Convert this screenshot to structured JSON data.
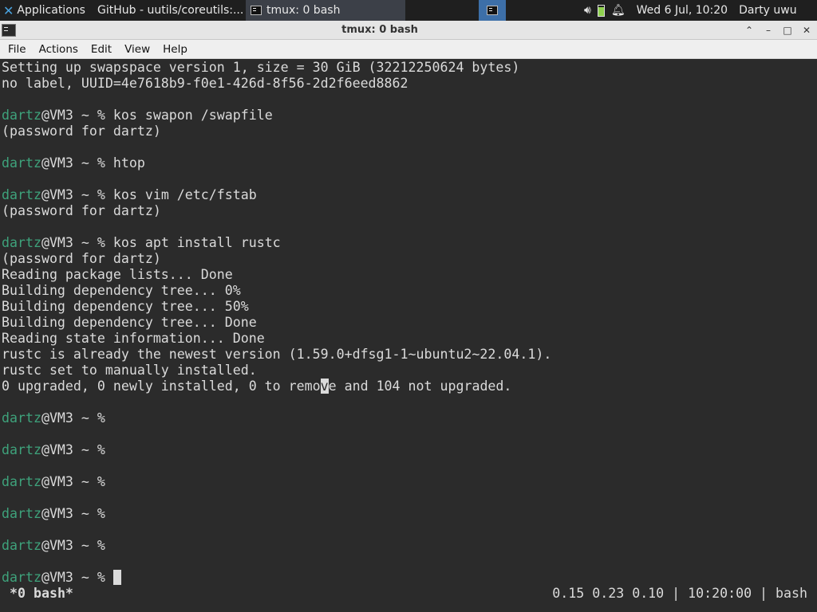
{
  "panel": {
    "applications_label": "Applications",
    "tasks": [
      {
        "label": "GitHub - uutils/coreutils:...",
        "icon": "firefox-icon"
      },
      {
        "label": "tmux: 0 bash",
        "icon": "terminal-icon"
      }
    ],
    "clock": "Wed  6 Jul, 10:20",
    "user": "Darty uwu",
    "accent": "#3d6fa8"
  },
  "window": {
    "title": "tmux: 0 bash"
  },
  "menubar": {
    "items": [
      "File",
      "Actions",
      "Edit",
      "View",
      "Help"
    ]
  },
  "terminal": {
    "colors": {
      "background": "#2b2b2b",
      "text": "#dadada",
      "prompt_user": "#3ea27b"
    },
    "prompt": {
      "user": "dartz",
      "rest": "@VM3 ~ % "
    },
    "lines": [
      {
        "type": "text",
        "text": "Setting up swapspace version 1, size = 30 GiB (32212250624 bytes)"
      },
      {
        "type": "text",
        "text": "no label, UUID=4e7618b9-f0e1-426d-8f56-2d2f6eed8862"
      },
      {
        "type": "blank"
      },
      {
        "type": "prompt",
        "cmd": "kos swapon /swapfile"
      },
      {
        "type": "text",
        "text": "(password for dartz)"
      },
      {
        "type": "blank"
      },
      {
        "type": "prompt",
        "cmd": "htop"
      },
      {
        "type": "blank"
      },
      {
        "type": "prompt",
        "cmd": "kos vim /etc/fstab"
      },
      {
        "type": "text",
        "text": "(password for dartz)"
      },
      {
        "type": "blank"
      },
      {
        "type": "prompt",
        "cmd": "kos apt install rustc"
      },
      {
        "type": "text",
        "text": "(password for dartz)"
      },
      {
        "type": "text",
        "text": "Reading package lists... Done"
      },
      {
        "type": "text",
        "text": "Building dependency tree... 0%"
      },
      {
        "type": "text",
        "text": "Building dependency tree... 50%"
      },
      {
        "type": "text",
        "text": "Building dependency tree... Done"
      },
      {
        "type": "text",
        "text": "Reading state information... Done"
      },
      {
        "type": "text",
        "text": "rustc is already the newest version (1.59.0+dfsg1-1~ubuntu2~22.04.1)."
      },
      {
        "type": "text",
        "text": "rustc set to manually installed."
      },
      {
        "type": "highlight",
        "before": "0 upgraded, 0 newly installed, 0 to remo",
        "hl": "v",
        "after": "e and 104 not upgraded."
      },
      {
        "type": "blank"
      },
      {
        "type": "prompt",
        "cmd": ""
      },
      {
        "type": "blank"
      },
      {
        "type": "prompt",
        "cmd": ""
      },
      {
        "type": "blank"
      },
      {
        "type": "prompt",
        "cmd": ""
      },
      {
        "type": "blank"
      },
      {
        "type": "prompt",
        "cmd": ""
      },
      {
        "type": "blank"
      },
      {
        "type": "prompt",
        "cmd": ""
      },
      {
        "type": "blank"
      },
      {
        "type": "prompt",
        "cmd": "",
        "cursor": true
      }
    ]
  },
  "tmux_status": {
    "window": "*0 bash*",
    "right": "0.15 0.23 0.10 | 10:20:00 | bash"
  }
}
